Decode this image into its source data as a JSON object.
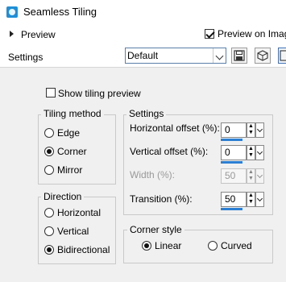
{
  "window": {
    "title": "Seamless Tiling",
    "accent": "#1f8fd6"
  },
  "preview": {
    "label": "Preview",
    "preview_on_image_label": "Preview on Image",
    "preview_on_image_checked": true
  },
  "settings": {
    "label": "Settings",
    "preset_value": "Default"
  },
  "toolbar_icons": [
    "save-icon",
    "randomize-icon",
    "reset-icon"
  ],
  "show_tiling_preview": {
    "label": "Show tiling preview",
    "checked": false
  },
  "tiling_method": {
    "title": "Tiling method",
    "options": [
      {
        "label": "Edge",
        "selected": false
      },
      {
        "label": "Corner",
        "selected": true
      },
      {
        "label": "Mirror",
        "selected": false
      }
    ]
  },
  "direction": {
    "title": "Direction",
    "options": [
      {
        "label": "Horizontal",
        "selected": false
      },
      {
        "label": "Vertical",
        "selected": false
      },
      {
        "label": "Bidirectional",
        "selected": true
      }
    ]
  },
  "settings_group": {
    "title": "Settings",
    "horizontal_offset": {
      "label": "Horizontal offset (%):",
      "value": "0"
    },
    "vertical_offset": {
      "label": "Vertical offset (%):",
      "value": "0"
    },
    "width": {
      "label": "Width (%):",
      "value": "50",
      "disabled": true
    },
    "transition": {
      "label": "Transition (%):",
      "value": "50"
    }
  },
  "corner_style": {
    "title": "Corner style",
    "options": [
      {
        "label": "Linear",
        "selected": true
      },
      {
        "label": "Curved",
        "selected": false
      }
    ]
  }
}
